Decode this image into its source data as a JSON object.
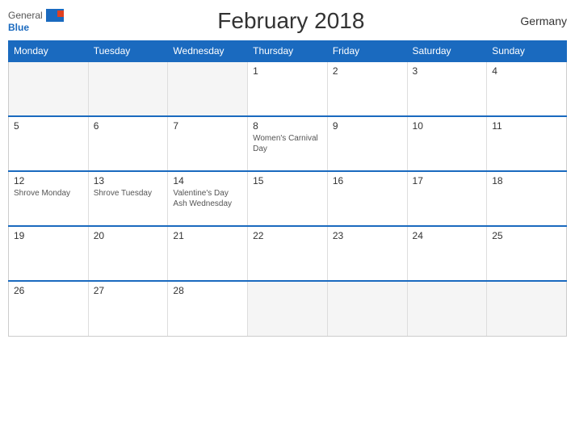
{
  "header": {
    "title": "February 2018",
    "country": "Germany",
    "logo_general": "General",
    "logo_blue": "Blue"
  },
  "days_of_week": [
    "Monday",
    "Tuesday",
    "Wednesday",
    "Thursday",
    "Friday",
    "Saturday",
    "Sunday"
  ],
  "weeks": [
    [
      {
        "day": "",
        "events": [],
        "empty": true
      },
      {
        "day": "",
        "events": [],
        "empty": true
      },
      {
        "day": "",
        "events": [],
        "empty": true
      },
      {
        "day": "1",
        "events": [],
        "empty": false
      },
      {
        "day": "2",
        "events": [],
        "empty": false
      },
      {
        "day": "3",
        "events": [],
        "empty": false
      },
      {
        "day": "4",
        "events": [],
        "empty": false
      }
    ],
    [
      {
        "day": "5",
        "events": [],
        "empty": false
      },
      {
        "day": "6",
        "events": [],
        "empty": false
      },
      {
        "day": "7",
        "events": [],
        "empty": false
      },
      {
        "day": "8",
        "events": [
          "Women's Carnival Day"
        ],
        "empty": false
      },
      {
        "day": "9",
        "events": [],
        "empty": false
      },
      {
        "day": "10",
        "events": [],
        "empty": false
      },
      {
        "day": "11",
        "events": [],
        "empty": false
      }
    ],
    [
      {
        "day": "12",
        "events": [
          "Shrove Monday"
        ],
        "empty": false
      },
      {
        "day": "13",
        "events": [
          "Shrove Tuesday"
        ],
        "empty": false
      },
      {
        "day": "14",
        "events": [
          "Valentine's Day",
          "Ash Wednesday"
        ],
        "empty": false
      },
      {
        "day": "15",
        "events": [],
        "empty": false
      },
      {
        "day": "16",
        "events": [],
        "empty": false
      },
      {
        "day": "17",
        "events": [],
        "empty": false
      },
      {
        "day": "18",
        "events": [],
        "empty": false
      }
    ],
    [
      {
        "day": "19",
        "events": [],
        "empty": false
      },
      {
        "day": "20",
        "events": [],
        "empty": false
      },
      {
        "day": "21",
        "events": [],
        "empty": false
      },
      {
        "day": "22",
        "events": [],
        "empty": false
      },
      {
        "day": "23",
        "events": [],
        "empty": false
      },
      {
        "day": "24",
        "events": [],
        "empty": false
      },
      {
        "day": "25",
        "events": [],
        "empty": false
      }
    ],
    [
      {
        "day": "26",
        "events": [],
        "empty": false
      },
      {
        "day": "27",
        "events": [],
        "empty": false
      },
      {
        "day": "28",
        "events": [],
        "empty": false
      },
      {
        "day": "",
        "events": [],
        "empty": true
      },
      {
        "day": "",
        "events": [],
        "empty": true
      },
      {
        "day": "",
        "events": [],
        "empty": true
      },
      {
        "day": "",
        "events": [],
        "empty": true
      }
    ]
  ]
}
